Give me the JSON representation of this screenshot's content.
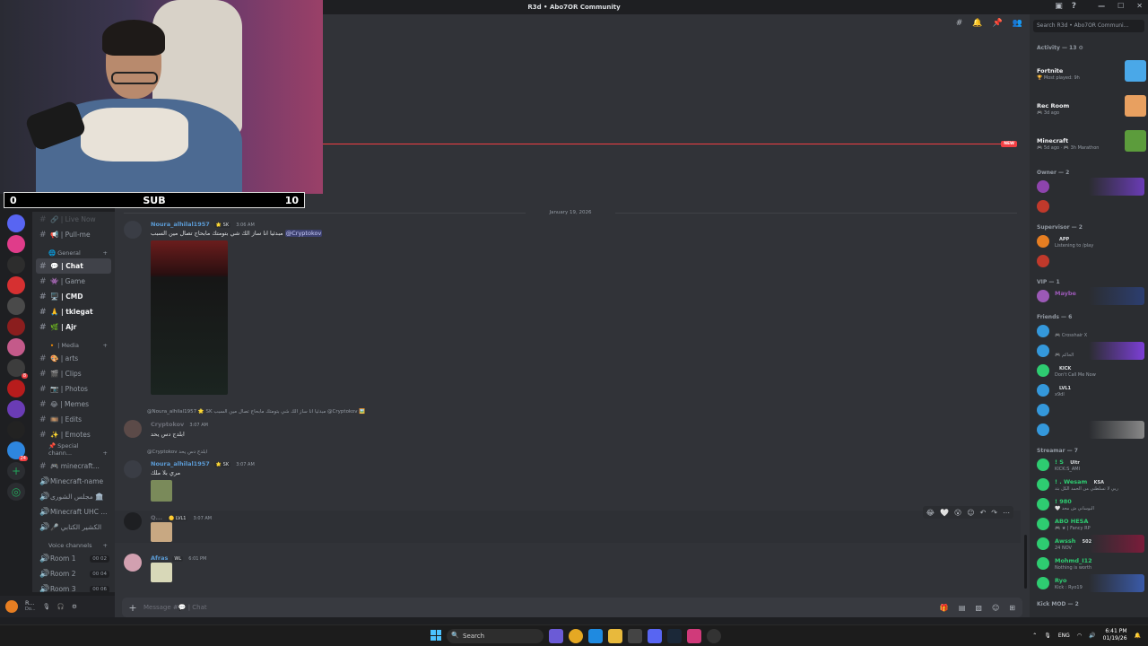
{
  "window": {
    "title": "R3d • Abo7OR Community"
  },
  "stream_overlay": {
    "left_count": "0",
    "center_label": "SUB",
    "right_count": "10"
  },
  "channels": [
    {
      "type": "text",
      "label": "🔗 | Live Now",
      "dim": true
    },
    {
      "type": "text",
      "label": "📢 | Pull-me"
    },
    {
      "type": "category",
      "label": "🌐 General"
    },
    {
      "type": "text",
      "label": "💬 | Chat",
      "active": true
    },
    {
      "type": "text",
      "label": "👾 | Game"
    },
    {
      "type": "text",
      "label": "🖥️ | CMD",
      "bold": true
    },
    {
      "type": "text",
      "label": "🙏 | tklegat",
      "bold": true
    },
    {
      "type": "text",
      "label": "🌿 | Ajr",
      "bold": true
    },
    {
      "type": "category",
      "label": "🔸 | Media"
    },
    {
      "type": "text",
      "label": "🎨 | arts"
    },
    {
      "type": "text",
      "label": "🎬 | Clips"
    },
    {
      "type": "text",
      "label": "📷 | Photos"
    },
    {
      "type": "text",
      "label": "😂 | Memes"
    },
    {
      "type": "text",
      "label": "🎞️ | Edits"
    },
    {
      "type": "text",
      "label": "✨ | Emotes"
    },
    {
      "type": "category",
      "label": "📌 Special chann..."
    },
    {
      "type": "text",
      "label": "🎮 minecraft..."
    },
    {
      "type": "voice",
      "label": "Minecraft-name"
    },
    {
      "type": "voice",
      "label": "مجلس الشورى 🏛️"
    },
    {
      "type": "voice",
      "label": "Minecraft UHC ..."
    },
    {
      "type": "voice",
      "label": "🎤 الكشير الكتابي"
    },
    {
      "type": "category",
      "label": "Voice channels"
    },
    {
      "type": "voice",
      "label": "Room 1",
      "count": "00 02"
    },
    {
      "type": "voice",
      "label": "Room 2",
      "count": "00 04"
    },
    {
      "type": "voice",
      "label": "Room 3",
      "count": "00 06"
    }
  ],
  "user_panel": {
    "name": "R...",
    "status": "Do..."
  },
  "chat": {
    "new_badge": "NEW",
    "date": "January 19, 2026",
    "messages": [
      {
        "user": "Noura_alhilal1957",
        "tag": "🌟 SK",
        "time": "3:06 AM",
        "text": "مبدئيا انا ساز الك شي بتومتك مابحاج تصال مين السبب",
        "mention": "@Cryptokov"
      },
      {
        "reply": "@Noura_alhilal1957 🌟 SK مبدئيا انا ساز الك شي بتومتك مابحاج تصال مين السبب @Cryptokov 🖼️",
        "user": "Cryptokov",
        "time": "3:07 AM",
        "text": "ابلدج دس يحد"
      },
      {
        "reply": "@Cryptokov ابلدج دس يحد",
        "user": "Noura_alhilal1957",
        "tag": "🌟 SK",
        "time": "3:07 AM",
        "text": "مري بلا ملك"
      },
      {
        "user": "Q...",
        "tag": "🟡 LVL1",
        "time": "3:07 AM",
        "text": ""
      },
      {
        "user": "Afras",
        "tag": "WL",
        "time": "6:01 PM",
        "text": ""
      }
    ],
    "composer_placeholder": "Message #💬 | Chat"
  },
  "members": {
    "search_placeholder": "Search R3d • Abo7OR Communi...",
    "activity_header": "Activity — 13 ⚙",
    "activities": [
      {
        "name": "Fortnite",
        "sub": "🏆 Most played: 9h",
        "color": "#4aa8e8"
      },
      {
        "name": "Rec Room",
        "sub": "🎮 3d ago",
        "color": "#e8a060"
      },
      {
        "name": "Minecraft",
        "sub": "🎮 5d ago · 🎮 3h Marathon",
        "color": "#5c9c3c"
      }
    ],
    "groups": [
      {
        "header": "Owner — 2",
        "members": [
          {
            "name": "",
            "sub": "",
            "color": "#8e44ad",
            "banner": "#6a3cb5"
          },
          {
            "name": "",
            "sub": "",
            "color": "#c0392b"
          }
        ]
      },
      {
        "header": "Supervisor — 2",
        "members": [
          {
            "name": "",
            "sub": "Listening to /play",
            "color": "#e67e22",
            "tag": "APP"
          },
          {
            "name": "",
            "sub": "",
            "color": "#c0392b"
          }
        ]
      },
      {
        "header": "VIP — 1",
        "members": [
          {
            "name": "Maybe",
            "sub": "",
            "color": "#9b59b6",
            "banner": "#2c3e70"
          }
        ]
      },
      {
        "header": "Friends — 6",
        "members": [
          {
            "name": "",
            "sub": "🎮 Crosshair X",
            "color": "#3498db"
          },
          {
            "name": "",
            "sub": "🎮 الحاكم",
            "color": "#3498db",
            "banner": "#7c3fd6"
          },
          {
            "name": "",
            "sub": "Don't Call Me Now",
            "color": "#2ecc71",
            "tag": "KICK"
          },
          {
            "name": "",
            "sub": "x9dl",
            "color": "#3498db",
            "tag": "LVL1"
          },
          {
            "name": "",
            "sub": "",
            "color": "#3498db"
          },
          {
            "name": "",
            "sub": "",
            "color": "#3498db",
            "banner": "#888"
          }
        ]
      },
      {
        "header": "Streamar — 7",
        "members": [
          {
            "name": "! S",
            "sub": "KICK:S_AMI",
            "color": "#2ecc71",
            "tag": "Ultr"
          },
          {
            "name": "! . Wesam",
            "sub": "ربي لا تسلطني من الحمد الكل بتد",
            "color": "#2ecc71",
            "tag": "KSA"
          },
          {
            "name": "! 980",
            "sub": "🤍 البوساني ش محد",
            "color": "#2ecc71"
          },
          {
            "name": "ABO HESA",
            "sub": "🎮 ★ | Fancy RP",
            "color": "#2ecc71"
          },
          {
            "name": "Awssh",
            "sub": "24 NOV",
            "color": "#2ecc71",
            "tag": "502",
            "banner": "#7a1c3a"
          },
          {
            "name": "Mohmd_I12",
            "sub": "Nothing is worth",
            "color": "#2ecc71"
          },
          {
            "name": "Ryo",
            "sub": "Kick : Ryo19",
            "color": "#2ecc71",
            "banner": "#3a5aa8"
          }
        ]
      },
      {
        "header": "Kick MOD — 2",
        "members": []
      }
    ]
  },
  "taskbar": {
    "search": "Search",
    "lang": "ENG",
    "time": "6:41 PM",
    "date": "01/19/26"
  },
  "colors": {
    "bg": "#313338",
    "sidebar": "#2b2d31",
    "rail": "#1e1f22",
    "accent": "#5865f2",
    "new": "#f23f43",
    "online": "#23a55a"
  }
}
